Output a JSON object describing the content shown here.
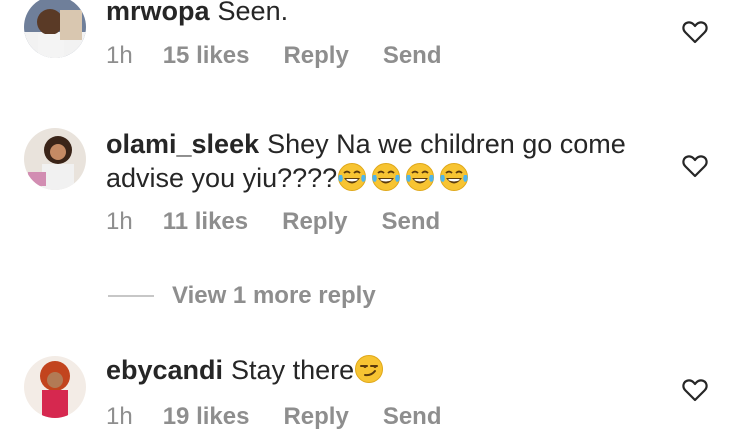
{
  "comments": [
    {
      "username": "mrwopa",
      "text": "Seen.",
      "time": "1h",
      "likes": "15 likes",
      "reply": "Reply",
      "send": "Send",
      "emojis": []
    },
    {
      "username": "olami_sleek",
      "text": "Shey Na we children go come advise you yiu????",
      "time": "1h",
      "likes": "11 likes",
      "reply": "Reply",
      "send": "Send",
      "emojis": [
        "tears-of-joy-emoji",
        "tears-of-joy-emoji",
        "tears-of-joy-emoji",
        "tears-of-joy-emoji"
      ]
    },
    {
      "username": "ebycandi",
      "text": "Stay there",
      "time": "1h",
      "likes": "19 likes",
      "reply": "Reply",
      "send": "Send",
      "emojis": [
        "smirking-face-emoji"
      ]
    }
  ],
  "view_more_replies": "View 1 more reply",
  "icons": {
    "like": "heart-outline-icon"
  },
  "colors": {
    "text": "#262626",
    "meta": "#8e8e8e",
    "divider": "#c7c7c7"
  }
}
